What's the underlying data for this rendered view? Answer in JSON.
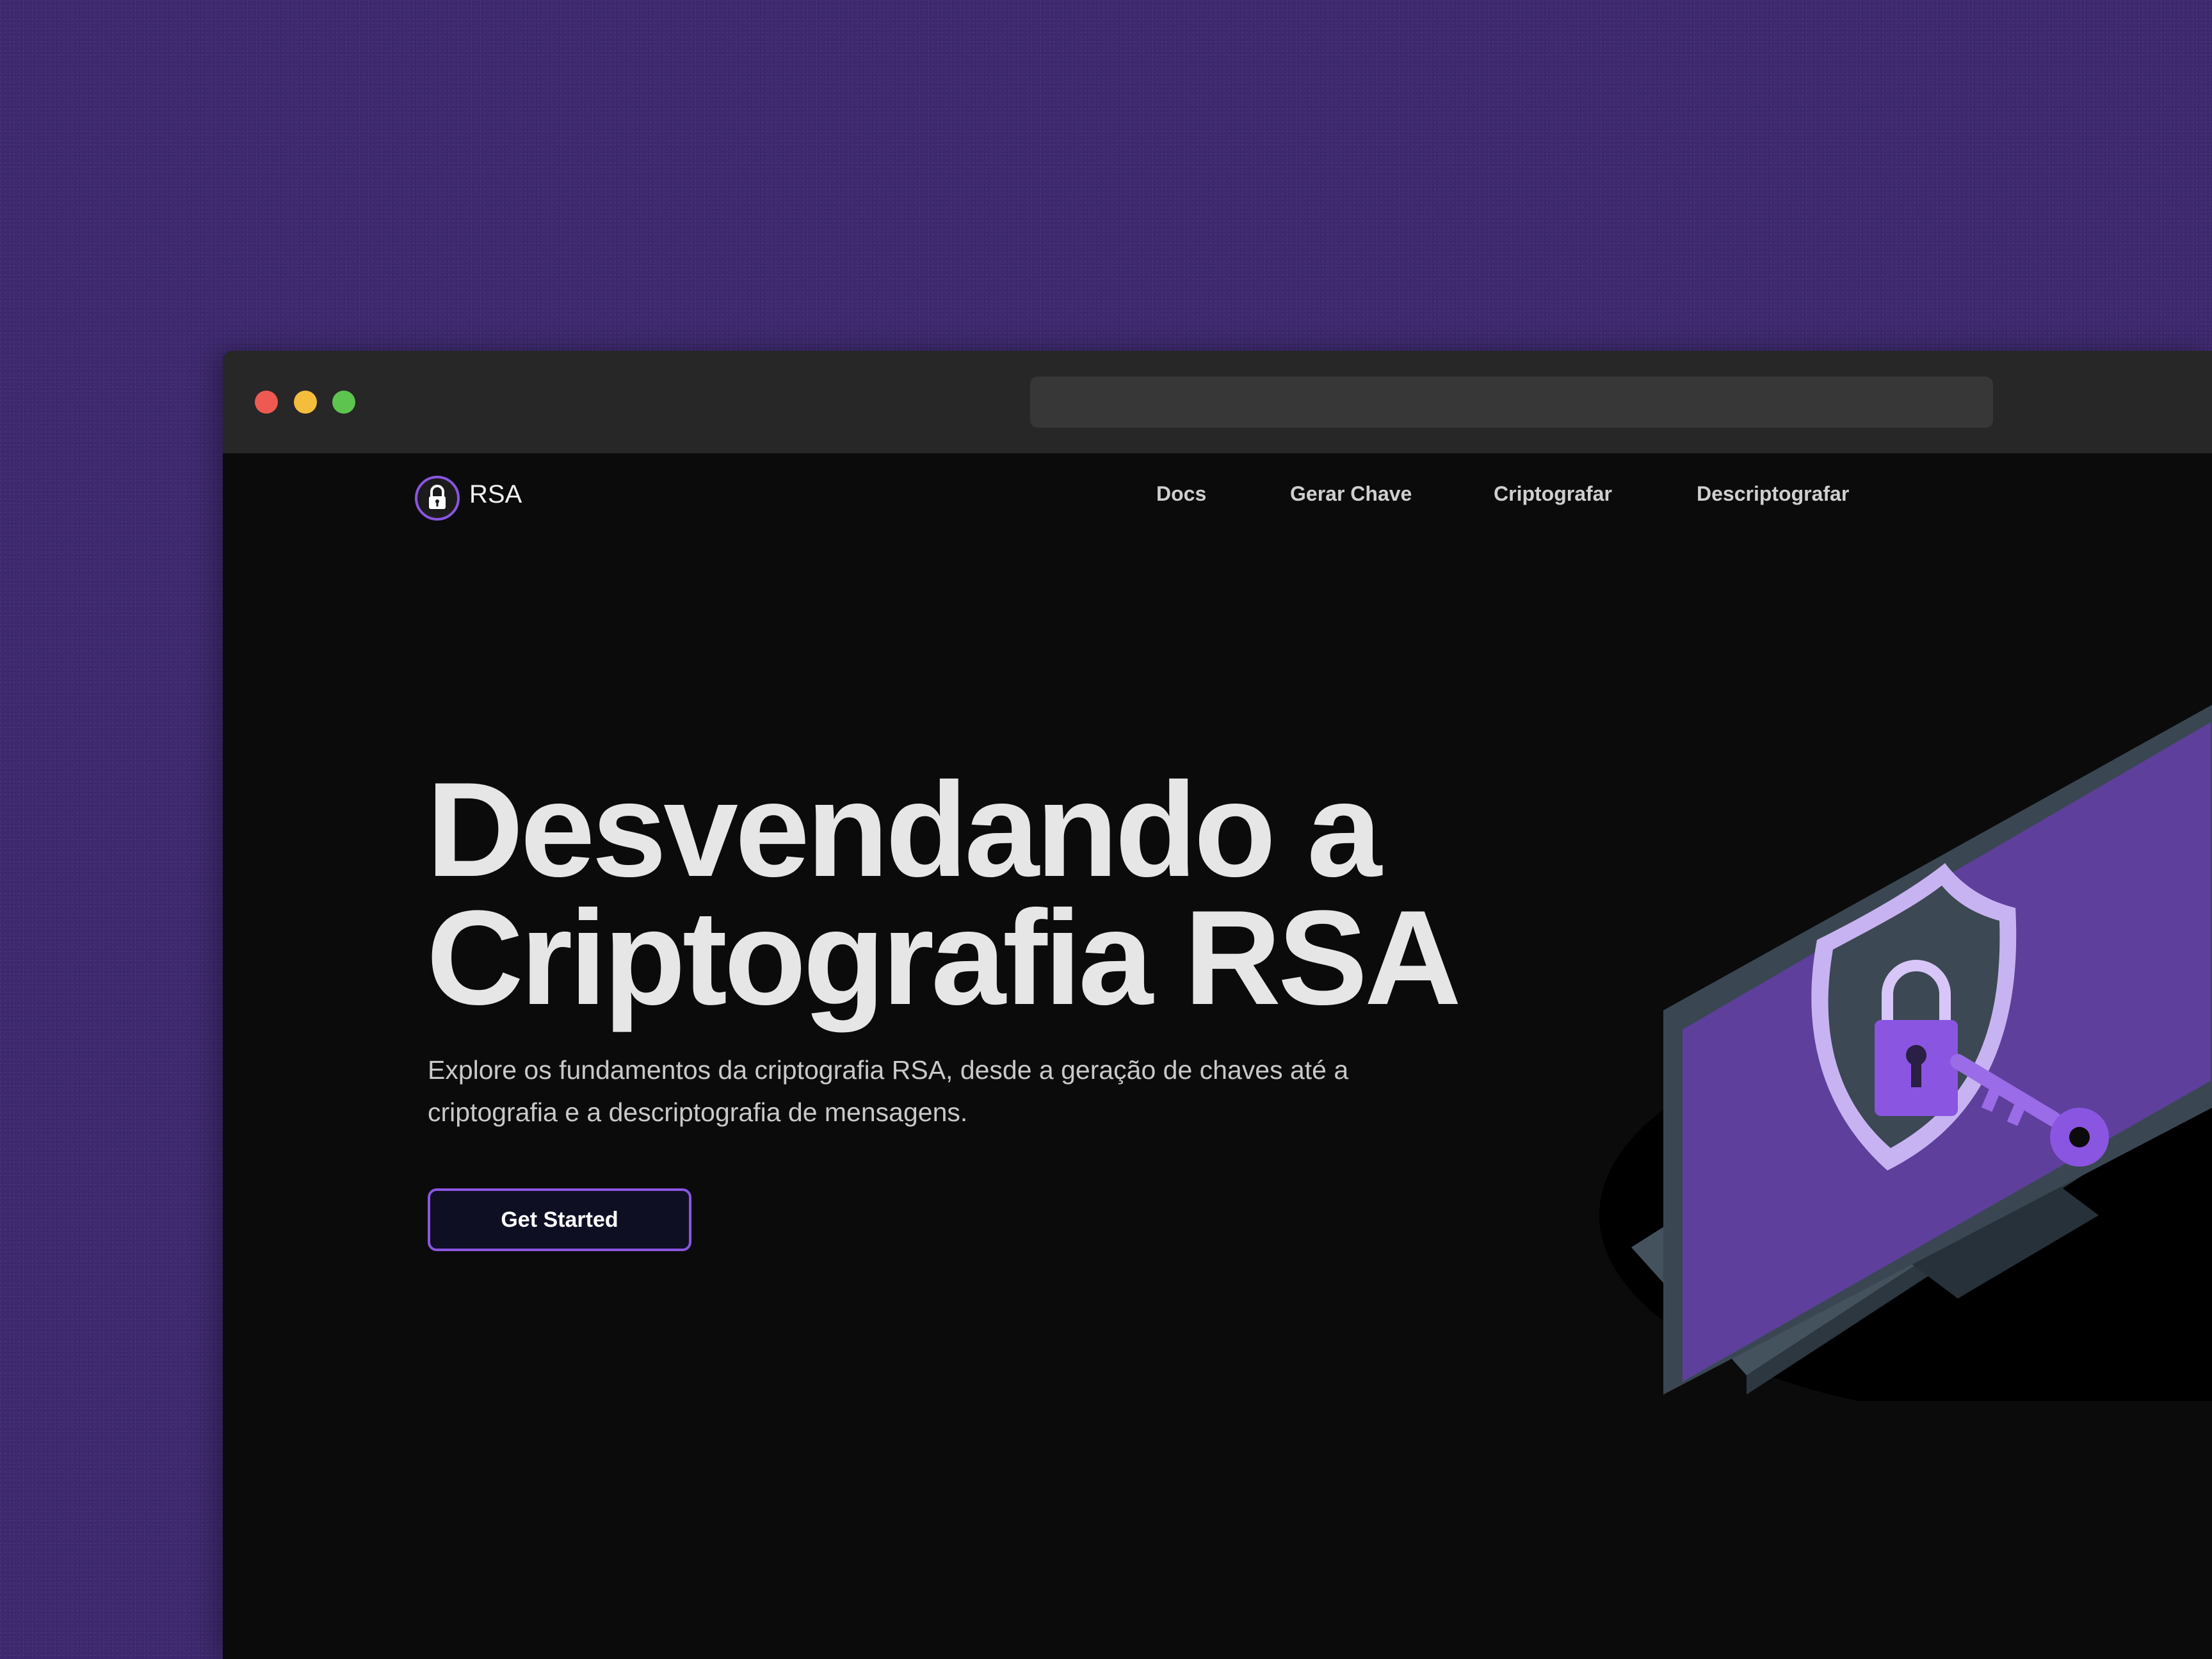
{
  "browser": {
    "traffic_lights": [
      "close",
      "minimize",
      "maximize"
    ],
    "url": ""
  },
  "nav": {
    "logo_icon": "padlock-icon",
    "brand": "RSA",
    "links": [
      "Docs",
      "Gerar Chave",
      "Criptografar",
      "Descriptografar"
    ]
  },
  "hero": {
    "title_line1": "Desvendando a",
    "title_line2": "Criptografia RSA",
    "subtitle": "Explore os fundamentos da criptografia RSA, desde a geração de chaves até a criptografia e a descriptografia de mensagens.",
    "cta_label": "Get Started",
    "illustration": "laptop-shield-lock-key-illustration"
  },
  "colors": {
    "background": "#3f2a72",
    "page": "#0b0b0b",
    "accent": "#8a55e0",
    "text": "#e6e6e6"
  }
}
